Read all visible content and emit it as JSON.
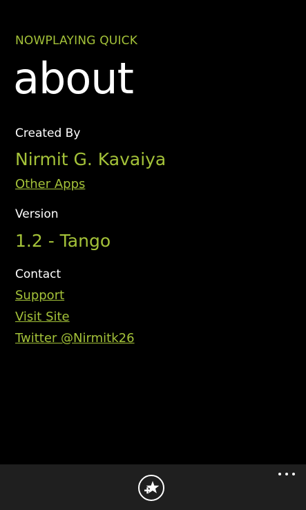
{
  "header": {
    "app_title": "NOWPLAYING QUICK",
    "page_title": "about"
  },
  "created_by": {
    "label": "Created By",
    "name": "Nirmit G. Kavaiya",
    "other_apps_link": "Other Apps"
  },
  "version": {
    "label": "Version",
    "value": "1.2 - Tango"
  },
  "contact": {
    "label": "Contact",
    "links": [
      "Support",
      "Visit Site",
      "Twitter @Nirmitk26"
    ]
  },
  "app_bar": {
    "button_icon": "star-plus-icon",
    "more_icon": "ellipsis-icon"
  },
  "colors": {
    "accent": "#a4c239",
    "background": "#000000",
    "app_bar": "#1f1f1f",
    "text": "#ffffff"
  }
}
